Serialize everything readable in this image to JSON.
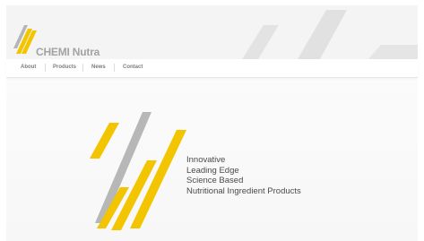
{
  "brand": {
    "name": "CHEMI Nutra",
    "colors": {
      "accent": "#f2c500",
      "gray": "#b7b7b7"
    }
  },
  "nav": {
    "items": [
      {
        "label": "About"
      },
      {
        "label": "Products"
      },
      {
        "label": "News"
      },
      {
        "label": "Contact"
      }
    ]
  },
  "hero": {
    "lines": [
      "Innovative",
      "Leading Edge",
      "Science Based",
      "Nutritional Ingredient Products"
    ]
  }
}
